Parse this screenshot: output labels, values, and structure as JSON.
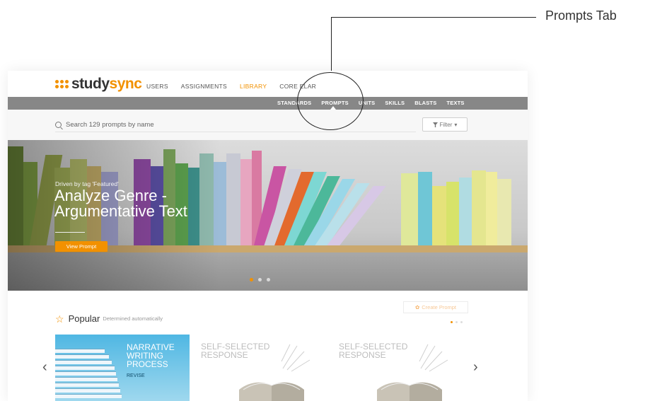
{
  "annotation": {
    "label": "Prompts Tab"
  },
  "brand": {
    "name_part1": "study",
    "name_part2": "sync",
    "accent_color": "#f29100"
  },
  "main_nav": {
    "items": [
      {
        "label": "USERS",
        "active": false
      },
      {
        "label": "ASSIGNMENTS",
        "active": false
      },
      {
        "label": "LIBRARY",
        "active": true
      },
      {
        "label": "CORE ELAR",
        "active": false
      }
    ]
  },
  "sub_nav": {
    "items": [
      {
        "label": "STANDARDS"
      },
      {
        "label": "PROMPTS"
      },
      {
        "label": "UNITS"
      },
      {
        "label": "SKILLS"
      },
      {
        "label": "BLASTS"
      },
      {
        "label": "TEXTS"
      }
    ],
    "selected": "PROMPTS"
  },
  "search": {
    "placeholder": "Search 129 prompts by name",
    "icon": "search-icon"
  },
  "filter": {
    "label": "Filter",
    "icon": "filter-icon"
  },
  "hero": {
    "tag": "Driven by tag 'Featured'",
    "title": "Analyze Genre - Argumentative Text",
    "button_label": "View Prompt",
    "slide_count": 3,
    "active_slide": 1
  },
  "popular": {
    "title": "Popular",
    "subtitle": "Determined automatically",
    "create_label": "Create Prompt",
    "page_count": 3,
    "active_page": 1,
    "cards": [
      {
        "title": "NARRATIVE WRITING PROCESS",
        "subtitle": "REVISE"
      },
      {
        "title": "SELF-SELECTED RESPONSE"
      },
      {
        "title": "SELF-SELECTED RESPONSE"
      }
    ]
  }
}
